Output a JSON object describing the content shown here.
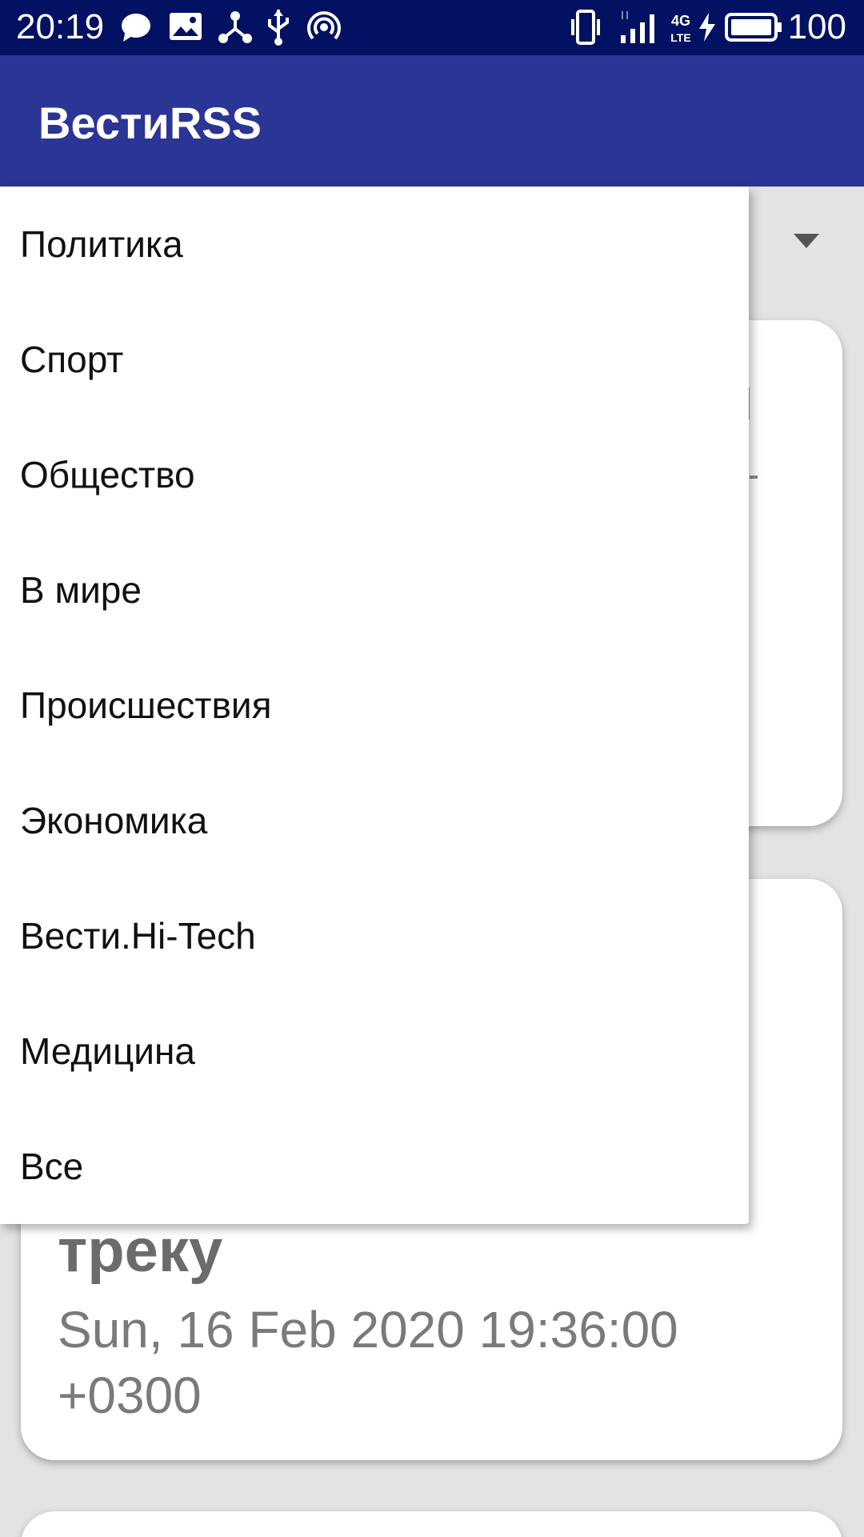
{
  "status_bar": {
    "time": "20:19",
    "battery": "100",
    "icons": [
      "chat-icon",
      "image-icon",
      "share-icon",
      "usb-icon",
      "hotspot-icon",
      "vibrate-icon",
      "signal-icon",
      "4g-lte-icon",
      "charging-icon",
      "battery-icon"
    ]
  },
  "app_bar": {
    "title": "ВестиRSS"
  },
  "dropdown": {
    "items": [
      "Политика",
      "Спорт",
      "Общество",
      "В мире",
      "Происшествия",
      "Экономика",
      "Вести.Hi-Tech",
      "Медицина",
      "Все"
    ]
  },
  "news_card": {
    "title_tail": "треку",
    "date": "Sun, 16 Feb 2020 19:36:00 +0300"
  }
}
